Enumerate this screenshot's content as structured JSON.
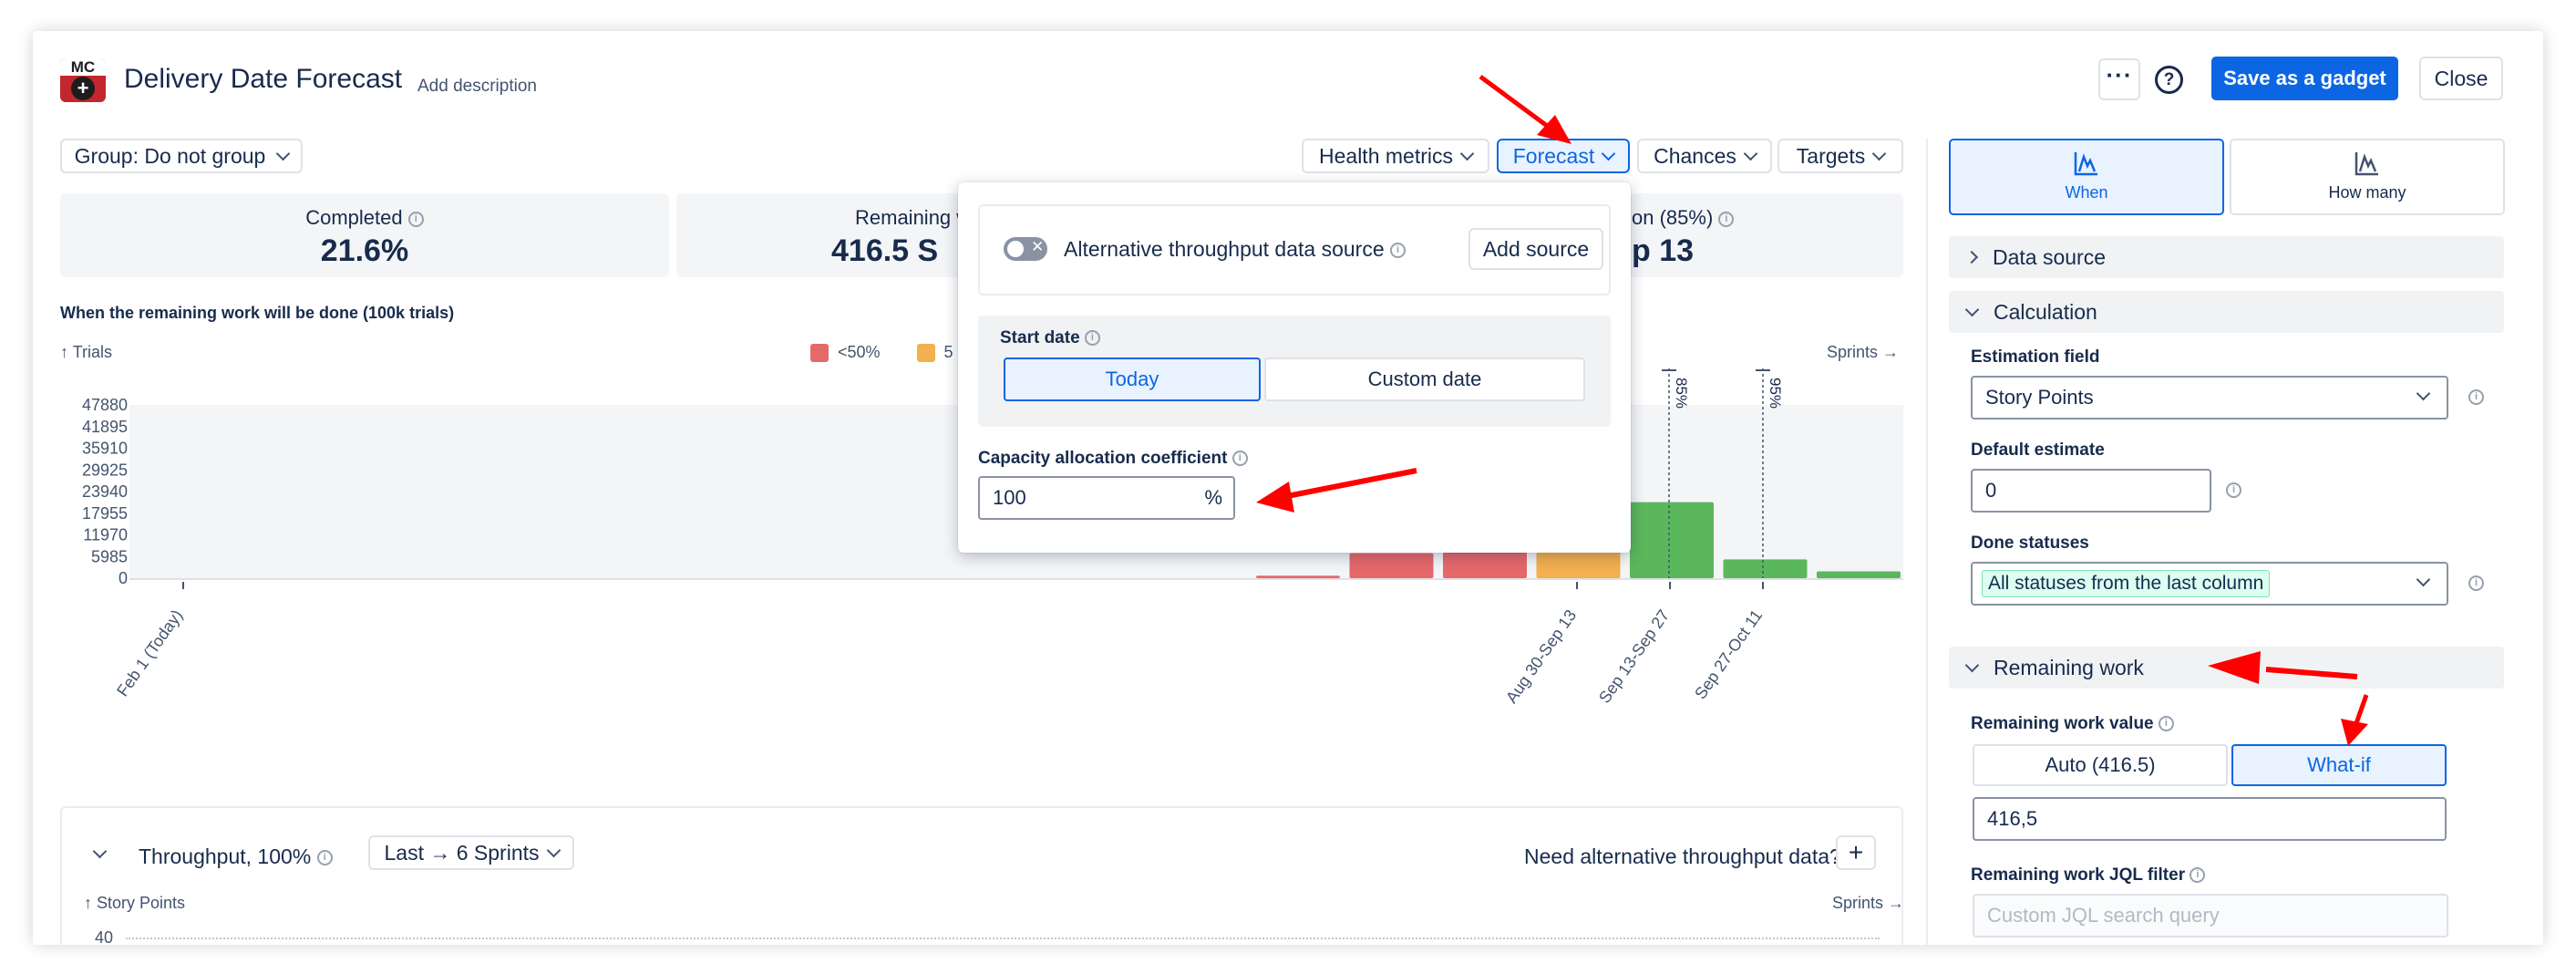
{
  "header": {
    "logo_text": "MC",
    "title": "Delivery Date Forecast",
    "add_description": "Add description",
    "more_icon": "ellipsis-icon",
    "help_icon": "question-circle-icon",
    "save_label": "Save as a gadget",
    "close_label": "Close"
  },
  "toolbar": {
    "group_label": "Group: Do not group",
    "health_metrics": "Health metrics",
    "forecast": "Forecast",
    "chances": "Chances",
    "targets": "Targets"
  },
  "stats": [
    {
      "label": "Completed",
      "value": "21.6%"
    },
    {
      "label": "Remaining w",
      "value": "416.5 S"
    },
    {
      "label": "on (85%)",
      "value": "p 13"
    }
  ],
  "chart": {
    "title": "When the remaining work will be done (100k trials)",
    "y_axis_label": "Trials",
    "x_axis_label": "Sprints",
    "legend": [
      {
        "label": "<50%",
        "color": "#e5686b"
      },
      {
        "label": "5",
        "color": "#f2b04e"
      }
    ],
    "marker_85": "85%",
    "marker_95": "95%"
  },
  "chart_data": {
    "type": "bar",
    "title": "When the remaining work will be done (100k trials)",
    "ylabel": "Trials",
    "xlabel": "Sprints",
    "ylim": [
      0,
      47880
    ],
    "y_ticks": [
      "47880",
      "41895",
      "35910",
      "29925",
      "23940",
      "17955",
      "11970",
      "5985",
      "0"
    ],
    "x_tick_labels": [
      "Feb 1 (Today)",
      "Aug 30-Sep 13",
      "Sep 13-Sep 27",
      "Sep 27-Oct 11"
    ],
    "bars": [
      {
        "value": 700,
        "color": "#e5686b"
      },
      {
        "value": 6900,
        "color": "#e5686b"
      },
      {
        "value": 14500,
        "color": "#e5686b"
      },
      {
        "value": 14500,
        "color": "#f2b04e"
      },
      {
        "value": 21000,
        "color": "#5bb75b"
      },
      {
        "value": 5200,
        "color": "#5bb75b"
      },
      {
        "value": 1900,
        "color": "#5bb75b"
      }
    ]
  },
  "throughput": {
    "title": "Throughput, 100%",
    "range": "Last → 6 Sprints",
    "need_alt": "Need alternative throughput data?",
    "add_icon": "plus-icon",
    "y_axis_label": "Story Points",
    "x_axis_label": "Sprints",
    "first_tick": "40"
  },
  "popup": {
    "alt_source_label": "Alternative throughput data source",
    "add_source": "Add source",
    "start_date_label": "Start date",
    "today": "Today",
    "custom_date": "Custom date",
    "capacity_label": "Capacity allocation coefficient",
    "capacity_value": "100",
    "capacity_unit": "%"
  },
  "right_panel": {
    "tab_when": "When",
    "tab_how_many": "How many",
    "data_source": "Data source",
    "calculation": "Calculation",
    "estimation_field_label": "Estimation field",
    "estimation_field_value": "Story Points",
    "default_estimate_label": "Default estimate",
    "default_estimate_value": "0",
    "done_statuses_label": "Done statuses",
    "done_statuses_value": "All statuses from the last column",
    "remaining_work": "Remaining work",
    "remaining_value_label": "Remaining work value",
    "auto_label": "Auto (416.5)",
    "whatif_label": "What-if",
    "remaining_input": "416,5",
    "jql_label": "Remaining work JQL filter",
    "jql_placeholder": "Custom JQL search query"
  },
  "colors": {
    "accent": "#0c66e4",
    "selected_bg": "#e9f2ff",
    "annotation": "#ff0000"
  }
}
